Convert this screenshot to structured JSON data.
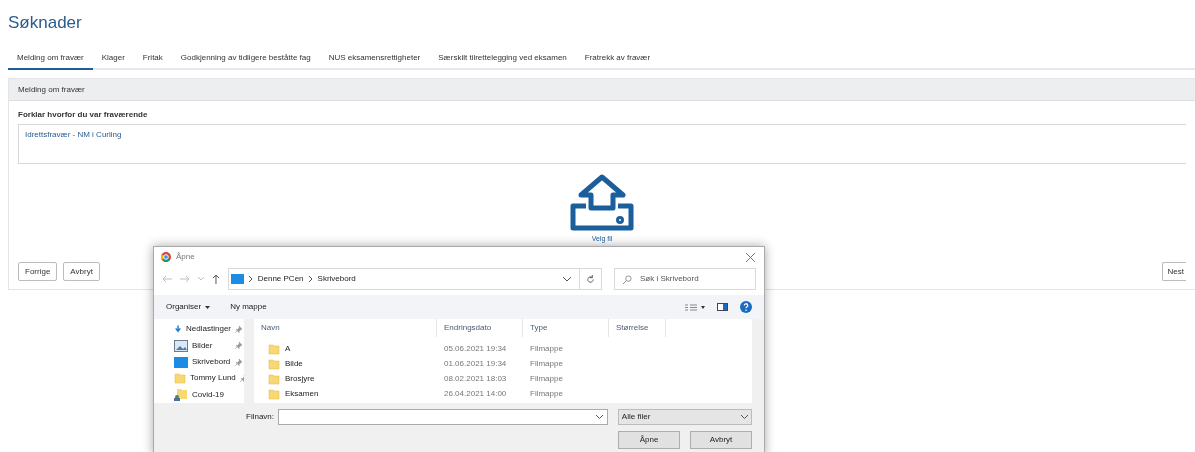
{
  "page_title": "Søknader",
  "tabs": [
    {
      "label": "Melding om fravær",
      "selected": true
    },
    {
      "label": "Klager",
      "selected": false
    },
    {
      "label": "Fritak",
      "selected": false
    },
    {
      "label": "Godkjenning av tidligere beståtte fag",
      "selected": false
    },
    {
      "label": "NUS eksamensrettigheter",
      "selected": false
    },
    {
      "label": "Særskilt tilrettelegging ved eksamen",
      "selected": false
    },
    {
      "label": "Fratrekk av fravær",
      "selected": false
    }
  ],
  "panel": {
    "header": "Melding om fravær",
    "field_label": "Forklar hvorfor du var fraværende",
    "field_value": "Idrettsfravær - NM i Curling",
    "upload_label": "Velg fil",
    "buttons_left": [
      "Forrige",
      "Avbryt"
    ],
    "button_right": "Nest"
  },
  "dialog": {
    "title": "Åpne",
    "path": [
      "Denne PCen",
      "Skrivebord"
    ],
    "search_placeholder": "Søk i Skrivebord",
    "toolbar": [
      "Organiser",
      "Ny mappe"
    ],
    "nav": [
      {
        "label": "Nedlastinger",
        "kind": "download",
        "pinned": true
      },
      {
        "label": "Bilder",
        "kind": "pictures",
        "pinned": true
      },
      {
        "label": "Skrivebord",
        "kind": "desktop",
        "pinned": true
      },
      {
        "label": "Tommy Lund",
        "kind": "folder",
        "pinned": true
      },
      {
        "label": "Covid-19",
        "kind": "shared",
        "pinned": false
      }
    ],
    "columns": [
      "Navn",
      "Endringsdato",
      "Type",
      "Størrelse"
    ],
    "rows": [
      {
        "name": "A",
        "date": "05.06.2021 19:34",
        "type": "Filmappe"
      },
      {
        "name": "Bilde",
        "date": "01.06.2021 19:34",
        "type": "Filmappe"
      },
      {
        "name": "Brosjyre",
        "date": "08.02.2021 18:03",
        "type": "Filmappe"
      },
      {
        "name": "Eksamen",
        "date": "26.04.2021 14:00",
        "type": "Filmappe"
      }
    ],
    "filename_label": "Filnavn:",
    "filter": "Alle filer",
    "buttons": [
      "Åpne",
      "Avbryt"
    ]
  }
}
